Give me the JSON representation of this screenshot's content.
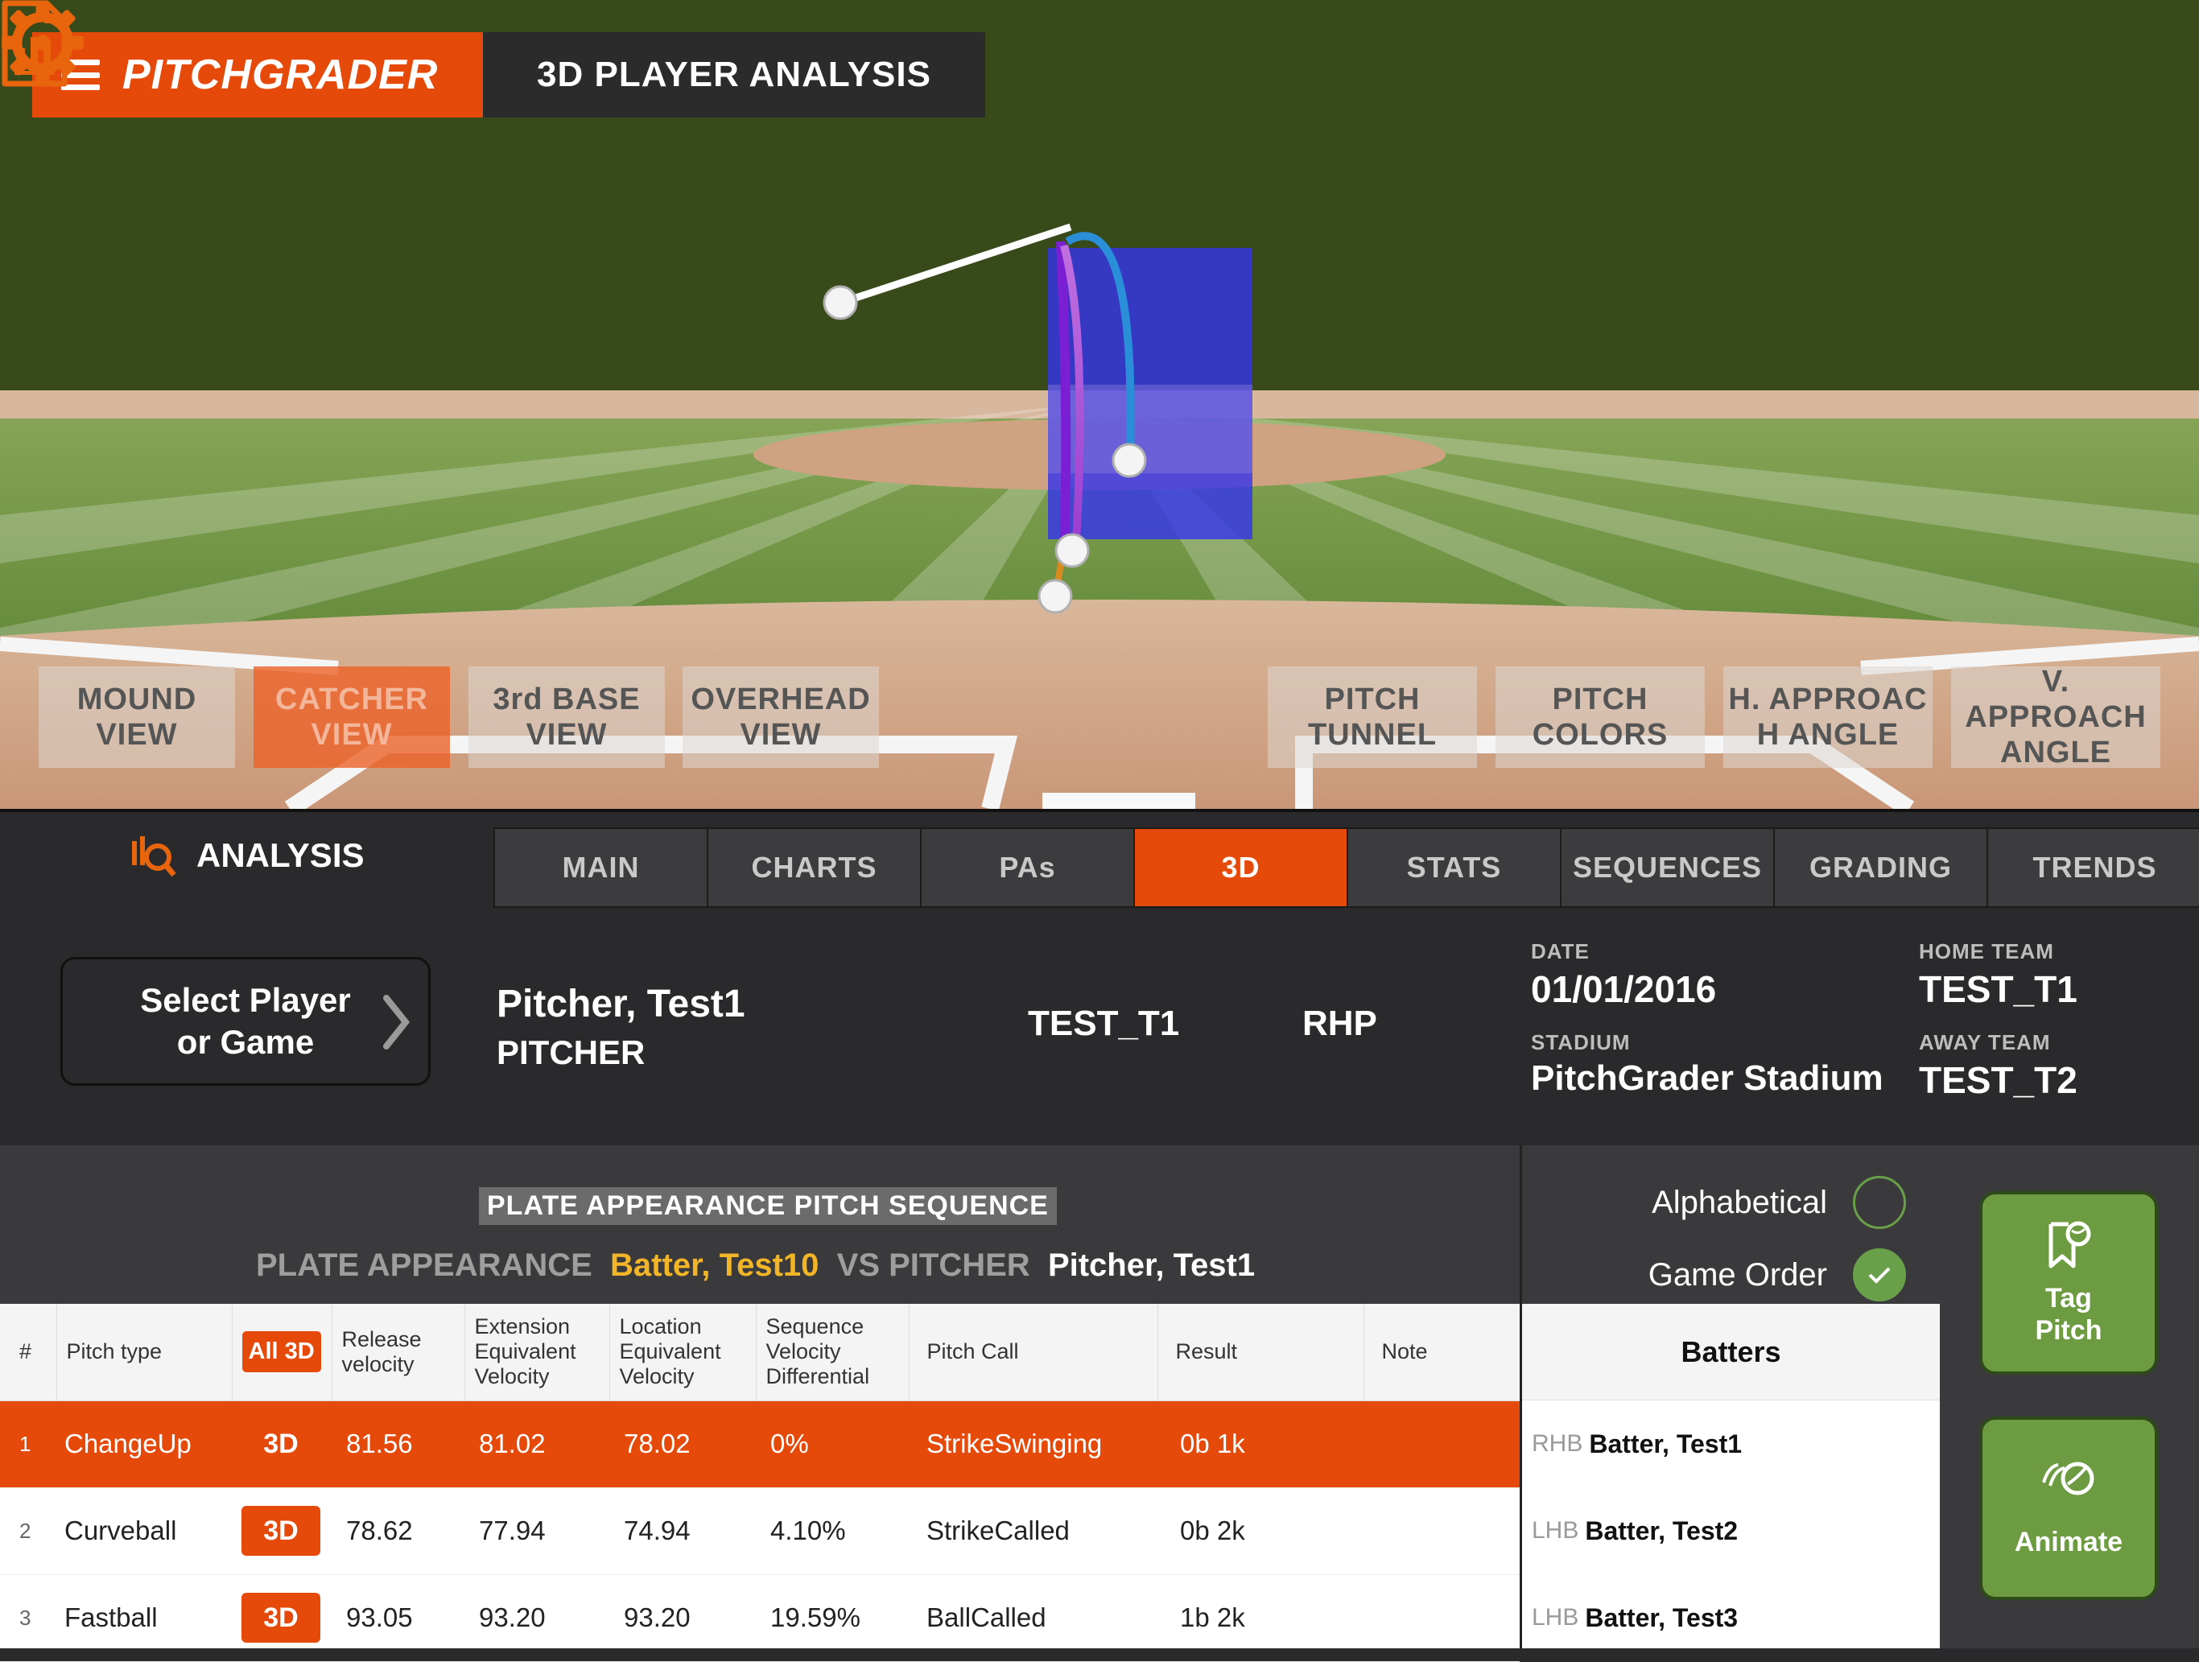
{
  "header": {
    "brand": "PITCHGRADER",
    "title": "3D PLAYER ANALYSIS"
  },
  "icons": {
    "settings": "gear-icon",
    "report": "report-icon",
    "menu": "hamburger-icon",
    "analysis": "analysis-icon"
  },
  "colors": {
    "accent": "#e64a0a",
    "action_green": "#6d9b42",
    "highlight_yellow": "#f2b527"
  },
  "camera_views": [
    {
      "label": "MOUND\nVIEW",
      "active": false
    },
    {
      "label": "CATCHER\nVIEW",
      "active": true
    },
    {
      "label": "3rd BASE\nVIEW",
      "active": false
    },
    {
      "label": "OVERHEAD\nVIEW",
      "active": false
    }
  ],
  "display_options": [
    {
      "label": "PITCH\nTUNNEL"
    },
    {
      "label": "PITCH\nCOLORS"
    },
    {
      "label": "H. APPROAC\nH ANGLE"
    },
    {
      "label": "V. APPROACH\nANGLE"
    }
  ],
  "analysis": {
    "label": "ANALYSIS",
    "tabs": [
      {
        "label": "MAIN",
        "active": false
      },
      {
        "label": "CHARTS",
        "active": false
      },
      {
        "label": "PAs",
        "active": false
      },
      {
        "label": "3D",
        "active": true
      },
      {
        "label": "STATS",
        "active": false
      },
      {
        "label": "SEQUENCES",
        "active": false
      },
      {
        "label": "GRADING",
        "active": false
      },
      {
        "label": "TRENDS",
        "active": false
      }
    ]
  },
  "info": {
    "select_label": "Select Player\nor Game",
    "player_name": "Pitcher, Test1",
    "player_role": "PITCHER",
    "team": "TEST_T1",
    "throws": "RHP",
    "date_label": "DATE",
    "date": "01/01/2016",
    "stadium_label": "STADIUM",
    "stadium": "PitchGrader Stadium",
    "home_team_label": "HOME TEAM",
    "home_team": "TEST_T1",
    "away_team_label": "AWAY TEAM",
    "away_team": "TEST_T2"
  },
  "sequence": {
    "title": "PLATE APPEARANCE PITCH SEQUENCE",
    "pa_label": "PLATE APPEARANCE",
    "batter": "Batter, Test10",
    "vs_label": "VS PITCHER",
    "pitcher": "Pitcher, Test1"
  },
  "table": {
    "headers": [
      "#",
      "Pitch type",
      "All 3D",
      "Release velocity",
      "Extension Equivalent Velocity",
      "Location Equivalent Velocity",
      "Sequence Velocity Differential",
      "Pitch Call",
      "Result",
      "Note"
    ],
    "rows": [
      {
        "num": "1",
        "type": "ChangeUp",
        "btn": "3D",
        "release": "81.56",
        "extension": "81.02",
        "location": "78.02",
        "seq_diff": "0%",
        "call": "StrikeSwinging",
        "result": "0b 1k",
        "note": "",
        "selected": true
      },
      {
        "num": "2",
        "type": "Curveball",
        "btn": "3D",
        "release": "78.62",
        "extension": "77.94",
        "location": "74.94",
        "seq_diff": "4.10%",
        "call": "StrikeCalled",
        "result": "0b 2k",
        "note": "",
        "selected": false
      },
      {
        "num": "3",
        "type": "Fastball",
        "btn": "3D",
        "release": "93.05",
        "extension": "93.20",
        "location": "93.20",
        "seq_diff": "19.59%",
        "call": "BallCalled",
        "result": "1b 2k",
        "note": "",
        "selected": false
      }
    ]
  },
  "sort": {
    "alphabetical": "Alphabetical",
    "game_order": "Game Order",
    "selected": "game_order"
  },
  "batters": {
    "header": "Batters",
    "list": [
      {
        "hand": "RHB",
        "name": "Batter, Test1"
      },
      {
        "hand": "LHB",
        "name": "Batter, Test2"
      },
      {
        "hand": "LHB",
        "name": "Batter, Test3"
      }
    ]
  },
  "actions": {
    "tag_pitch": "Tag\nPitch",
    "animate": "Animate"
  }
}
